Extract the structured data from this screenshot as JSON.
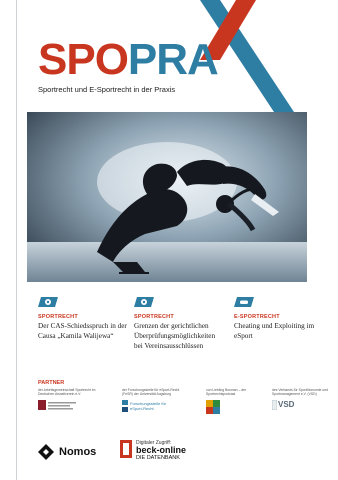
{
  "header": {
    "logo_part1": "SPO",
    "logo_part2": "PRA",
    "tagline": "Sportrecht und E-Sportrecht in der Praxis"
  },
  "teasers": [
    {
      "icon": "soccer-ball-icon",
      "category": "SPORTRECHT",
      "text": "Der CAS-Schiedsspruch in der Causa „Kamila Walijewa“"
    },
    {
      "icon": "soccer-ball-icon",
      "category": "SPORTRECHT",
      "text": "Grenzen der gerichtlichen Überprüfungsmöglichkeiten bei Vereinsausschlüssen"
    },
    {
      "icon": "gamepad-icon",
      "category": "E-SPORTRECHT",
      "text": "Cheating und Exploiting im eSport"
    }
  ],
  "partners": {
    "heading": "PARTNER",
    "items": [
      {
        "text": "der Arbeitsgemeinschaft Sportrecht im Deutschen Anwaltverein e.V."
      },
      {
        "text": "der Forschungsstelle für eSport-Recht (FeSR) der Universität Augsburg",
        "logo_text": "Forschungsstelle für eSport-Recht"
      },
      {
        "text": "von Liebling Bosman – der Sportrechtspodcast"
      },
      {
        "text": "des Verbands für Sportökonomie und Sportmanagement e.V. (VSD)",
        "logo_text": "VSD"
      }
    ]
  },
  "footer": {
    "publisher": "Nomos",
    "digital_label": "Digitaler Zugriff:",
    "beck_name": "beck-online",
    "beck_sub": "DIE DATENBANK"
  },
  "colors": {
    "accent_red": "#c9361f",
    "accent_blue": "#2e7da3"
  }
}
